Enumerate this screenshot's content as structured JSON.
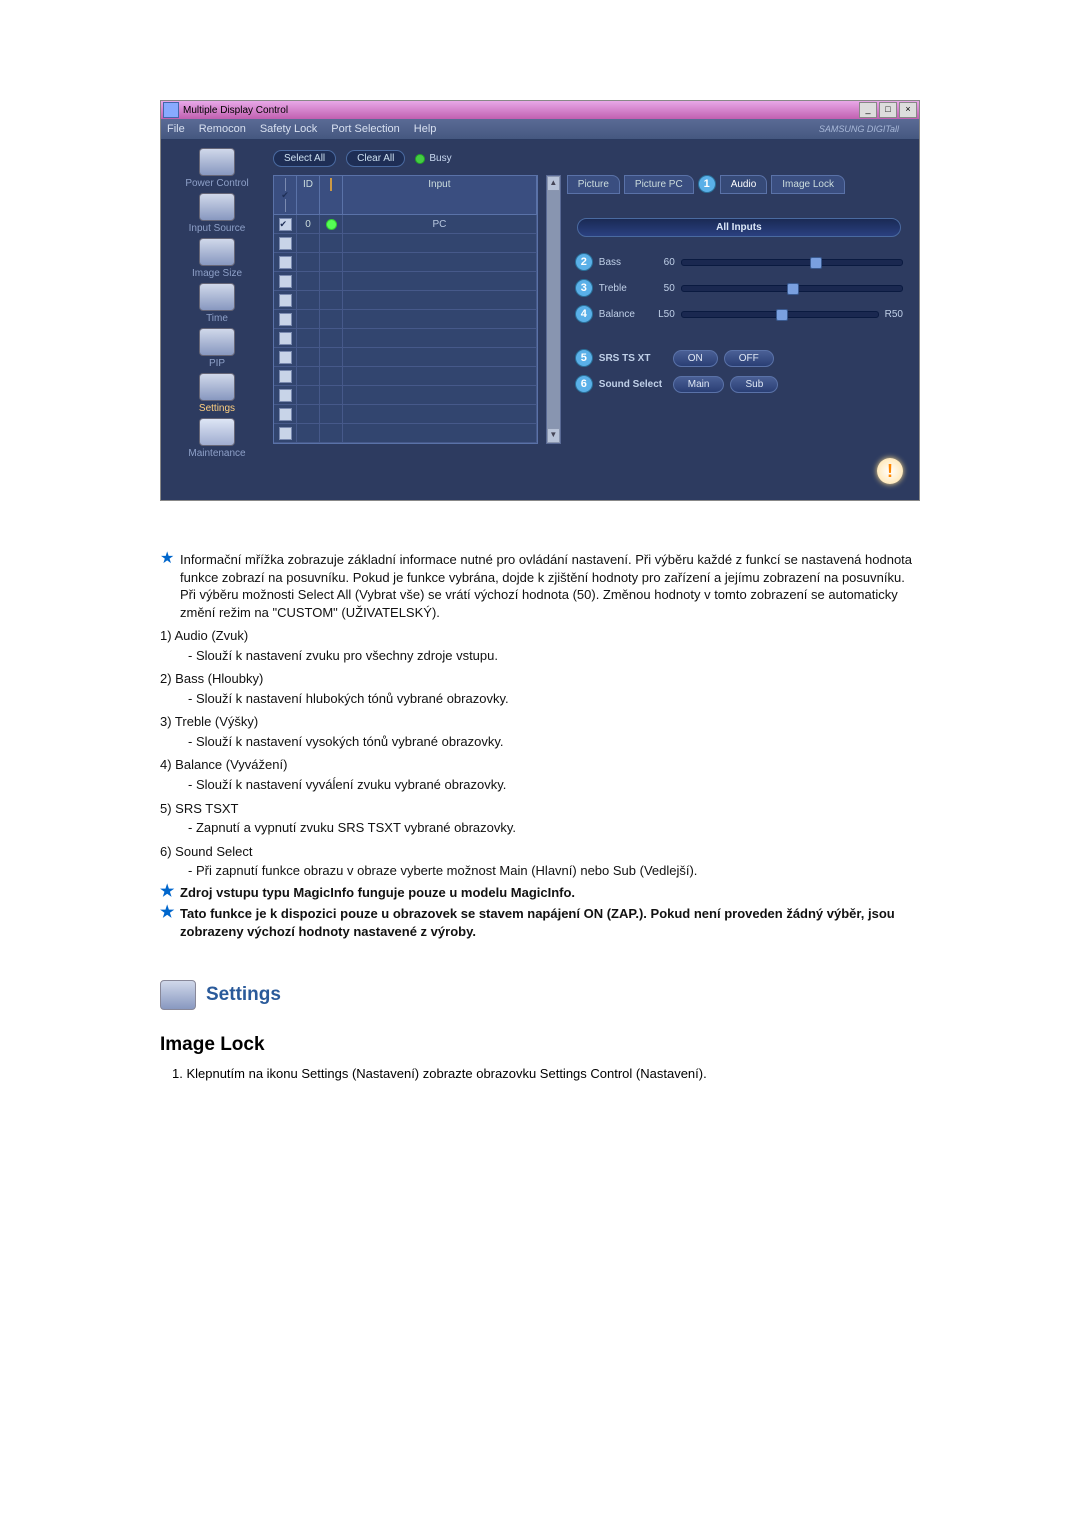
{
  "app": {
    "title": "Multiple Display Control",
    "menus": [
      "File",
      "Remocon",
      "Safety Lock",
      "Port Selection",
      "Help"
    ],
    "brand": "SAMSUNG DIGITall"
  },
  "sidebar": {
    "items": [
      {
        "label": "Power Control"
      },
      {
        "label": "Input Source"
      },
      {
        "label": "Image Size"
      },
      {
        "label": "Time"
      },
      {
        "label": "PIP"
      },
      {
        "label": "Settings"
      },
      {
        "label": "Maintenance"
      }
    ]
  },
  "toolbar": {
    "selectAll": "Select All",
    "clearAll": "Clear All",
    "busy": "Busy"
  },
  "grid": {
    "h1": "",
    "h2": "ID",
    "h3": "",
    "h4": "Input",
    "row0": {
      "id": "0",
      "input": "PC"
    }
  },
  "tabs": {
    "t1": "Picture",
    "t2": "Picture PC",
    "t3": "Audio",
    "t4": "Image Lock"
  },
  "sliders": {
    "allInputs": "All Inputs",
    "bass": {
      "label": "Bass",
      "val": "60"
    },
    "treble": {
      "label": "Treble",
      "val": "50"
    },
    "balance": {
      "label": "Balance",
      "valL": "L50",
      "valR": "R50"
    }
  },
  "buttons": {
    "srs": {
      "label": "SRS TS XT",
      "on": "ON",
      "off": "OFF"
    },
    "ss": {
      "label": "Sound Select",
      "main": "Main",
      "sub": "Sub"
    }
  },
  "notes": {
    "info": "Informační mřížka zobrazuje základní informace nutné pro ovládání nastavení. Při výběru každé z funkcí se nastavená hodnota funkce zobrazí na posuvníku. Pokud je funkce vybrána, dojde k zjištění hodnoty pro zařízení a jejímu zobrazení na posuvníku. Při výběru možnosti Select All (Vybrat vše) se vrátí výchozí hodnota (50). Změnou hodnoty v tomto zobrazení se automaticky změní režim na \"CUSTOM\" (UŽIVATELSKÝ).",
    "i1t": "1)  Audio (Zvuk)",
    "i1d": "- Slouží k nastavení zvuku pro všechny zdroje vstupu.",
    "i2t": "2)  Bass (Hloubky)",
    "i2d": "- Slouží k nastavení hlubokých tónů vybrané obrazovky.",
    "i3t": "3)  Treble (Výšky)",
    "i3d": "- Slouží k nastavení vysokých tónů vybrané obrazovky.",
    "i4t": "4)  Balance (Vyvážení)",
    "i4d": "- Slouží k nastavení vyváĺení zvuku vybrané obrazovky.",
    "i5t": "5)  SRS TSXT",
    "i5d": "- Zapnutí a vypnutí zvuku SRS TSXT vybrané obrazovky.",
    "i6t": "6)  Sound Select",
    "i6d": "- Při zapnutí funkce obrazu v obraze vyberte možnost Main (Hlavní) nebo Sub (Vedlejší).",
    "b1": "Zdroj vstupu typu MagicInfo funguje pouze u modelu MagicInfo.",
    "b2": "Tato funkce je k dispozici pouze u obrazovek se stavem napájení ON (ZAP.). Pokud není proveden žádný výběr, jsou zobrazeny výchozí hodnoty nastavené z výroby."
  },
  "section": {
    "title": "Settings",
    "sub": "Image Lock",
    "step": "1.  Klepnutím na ikonu Settings (Nastavení) zobrazte obrazovku Settings Control (Nastavení)."
  }
}
